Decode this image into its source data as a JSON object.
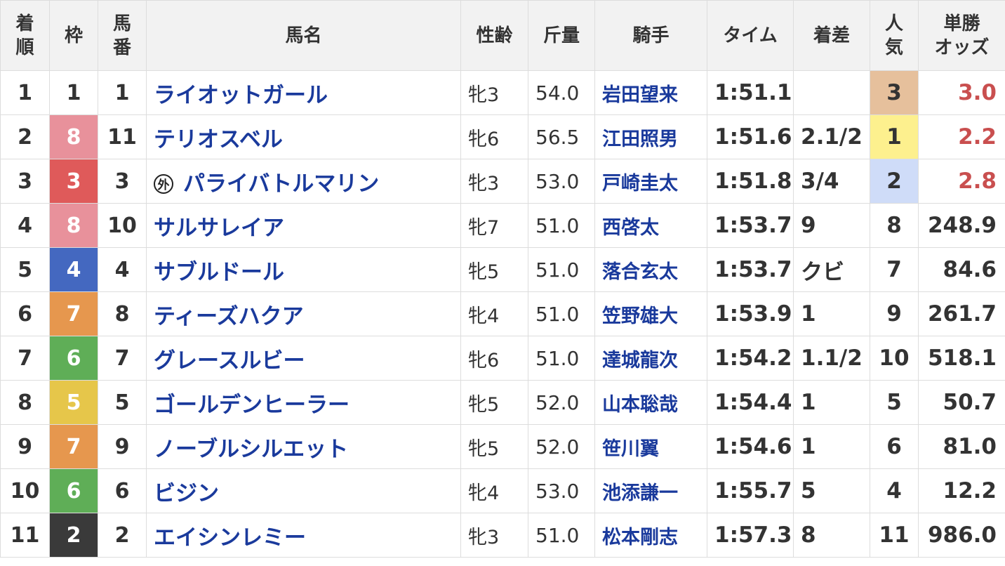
{
  "colors": {
    "gate_text_light": "#ffffff",
    "gate_text_dark": "#333333",
    "link": "#1a3a9c",
    "odds_highlight": "#c94f4f",
    "pop1_bg": "#fdf08e",
    "pop2_bg": "#cfdcf8",
    "pop3_bg": "#e6c09c"
  },
  "headers": {
    "rank": [
      "着",
      "順"
    ],
    "gate": "枠",
    "num": [
      "馬",
      "番"
    ],
    "horse": "馬名",
    "sexage": "性齢",
    "weight": "斤量",
    "jockey": "騎手",
    "time": "タイム",
    "margin": "着差",
    "pop": [
      "人",
      "気"
    ],
    "odds": [
      "単勝",
      "オッズ"
    ]
  },
  "rows": [
    {
      "rank": "1",
      "gate": "1",
      "gate_bg": "#ffffff",
      "gate_fg": "#333333",
      "num": "1",
      "mark": "",
      "horse": "ライオットガール",
      "sexage": "牝3",
      "weight": "54.0",
      "jockey": "岩田望来",
      "time": "1:51.1",
      "margin": "",
      "pop": "3",
      "pop_bg": "#e6c09c",
      "odds": "3.0",
      "odds_color": "#c94f4f"
    },
    {
      "rank": "2",
      "gate": "8",
      "gate_bg": "#e8919b",
      "gate_fg": "#ffffff",
      "num": "11",
      "mark": "",
      "horse": "テリオスベル",
      "sexage": "牝6",
      "weight": "56.5",
      "jockey": "江田照男",
      "time": "1:51.6",
      "margin": "2.1/2",
      "pop": "1",
      "pop_bg": "#fdf08e",
      "odds": "2.2",
      "odds_color": "#c94f4f"
    },
    {
      "rank": "3",
      "gate": "3",
      "gate_bg": "#df5a5a",
      "gate_fg": "#ffffff",
      "num": "3",
      "mark": "外",
      "horse": "パライバトルマリン",
      "sexage": "牝3",
      "weight": "53.0",
      "jockey": "戸崎圭太",
      "time": "1:51.8",
      "margin": "3/4",
      "pop": "2",
      "pop_bg": "#cfdcf8",
      "odds": "2.8",
      "odds_color": "#c94f4f"
    },
    {
      "rank": "4",
      "gate": "8",
      "gate_bg": "#e8919b",
      "gate_fg": "#ffffff",
      "num": "10",
      "mark": "",
      "horse": "サルサレイア",
      "sexage": "牝7",
      "weight": "51.0",
      "jockey": "西啓太",
      "time": "1:53.7",
      "margin": "9",
      "pop": "8",
      "pop_bg": "#ffffff",
      "odds": "248.9",
      "odds_color": "#333333"
    },
    {
      "rank": "5",
      "gate": "4",
      "gate_bg": "#4468c0",
      "gate_fg": "#ffffff",
      "num": "4",
      "mark": "",
      "horse": "サブルドール",
      "sexage": "牝5",
      "weight": "51.0",
      "jockey": "落合玄太",
      "time": "1:53.7",
      "margin": "クビ",
      "pop": "7",
      "pop_bg": "#ffffff",
      "odds": "84.6",
      "odds_color": "#333333"
    },
    {
      "rank": "6",
      "gate": "7",
      "gate_bg": "#e6974e",
      "gate_fg": "#ffffff",
      "num": "8",
      "mark": "",
      "horse": "ティーズハクア",
      "sexage": "牝4",
      "weight": "51.0",
      "jockey": "笠野雄大",
      "time": "1:53.9",
      "margin": "1",
      "pop": "9",
      "pop_bg": "#ffffff",
      "odds": "261.7",
      "odds_color": "#333333"
    },
    {
      "rank": "7",
      "gate": "6",
      "gate_bg": "#5fae57",
      "gate_fg": "#ffffff",
      "num": "7",
      "mark": "",
      "horse": "グレースルビー",
      "sexage": "牝6",
      "weight": "51.0",
      "jockey": "達城龍次",
      "time": "1:54.2",
      "margin": "1.1/2",
      "pop": "10",
      "pop_bg": "#ffffff",
      "odds": "518.1",
      "odds_color": "#333333"
    },
    {
      "rank": "8",
      "gate": "5",
      "gate_bg": "#e6c64a",
      "gate_fg": "#ffffff",
      "num": "5",
      "mark": "",
      "horse": "ゴールデンヒーラー",
      "sexage": "牝5",
      "weight": "52.0",
      "jockey": "山本聡哉",
      "time": "1:54.4",
      "margin": "1",
      "pop": "5",
      "pop_bg": "#ffffff",
      "odds": "50.7",
      "odds_color": "#333333"
    },
    {
      "rank": "9",
      "gate": "7",
      "gate_bg": "#e6974e",
      "gate_fg": "#ffffff",
      "num": "9",
      "mark": "",
      "horse": "ノーブルシルエット",
      "sexage": "牝5",
      "weight": "52.0",
      "jockey": "笹川翼",
      "time": "1:54.6",
      "margin": "1",
      "pop": "6",
      "pop_bg": "#ffffff",
      "odds": "81.0",
      "odds_color": "#333333"
    },
    {
      "rank": "10",
      "gate": "6",
      "gate_bg": "#5fae57",
      "gate_fg": "#ffffff",
      "num": "6",
      "mark": "",
      "horse": "ビジン",
      "sexage": "牝4",
      "weight": "53.0",
      "jockey": "池添謙一",
      "time": "1:55.7",
      "margin": "5",
      "pop": "4",
      "pop_bg": "#ffffff",
      "odds": "12.2",
      "odds_color": "#333333"
    },
    {
      "rank": "11",
      "gate": "2",
      "gate_bg": "#3a3a3a",
      "gate_fg": "#ffffff",
      "num": "2",
      "mark": "",
      "horse": "エイシンレミー",
      "sexage": "牝3",
      "weight": "51.0",
      "jockey": "松本剛志",
      "time": "1:57.3",
      "margin": "8",
      "pop": "11",
      "pop_bg": "#ffffff",
      "odds": "986.0",
      "odds_color": "#333333"
    }
  ]
}
